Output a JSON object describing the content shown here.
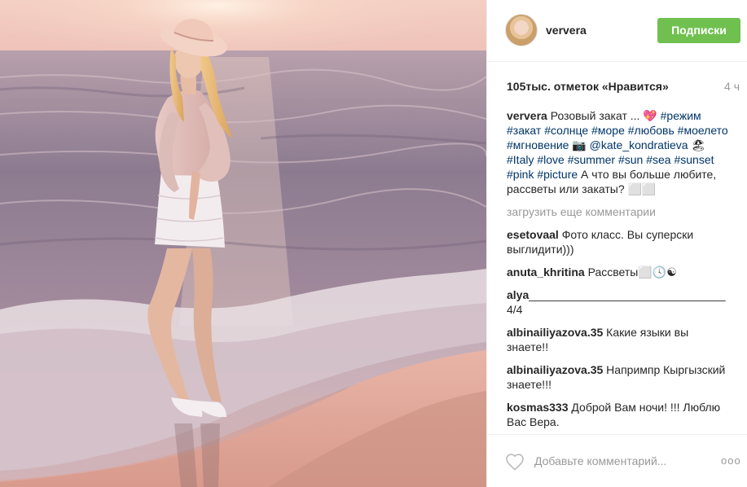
{
  "post": {
    "username": "ververa",
    "follow_label": "Подписки",
    "likes": "105тыс. отметок «Нравится»",
    "time": "4 ч",
    "caption": {
      "user": "ververa",
      "t1": " Розовый закат ... 💖 ",
      "h1": "#режим",
      "s1": " ",
      "h2": "#закат",
      "s2": " ",
      "h3": "#солнце",
      "s3": " ",
      "h4": "#море",
      "s4": " ",
      "h5": "#любовь",
      "s5": " ",
      "h6": "#моелето",
      "s6": " ",
      "h7": "#мгновение",
      "t2": " 📷 ",
      "m1": "@kate_kondratieva",
      "t3": " 🏖 ",
      "h8": "#Italy",
      "s8": " ",
      "h9": "#love",
      "s9": " ",
      "h10": "#summer",
      "s10": " ",
      "h11": "#sun",
      "s11": " ",
      "h12": "#sea",
      "s12": " ",
      "h13": "#sunset",
      "s13": " ",
      "h14": "#pink",
      "s14": " ",
      "h15": "#picture",
      "t4": " А что вы больше любите, рассветы или закаты? ⬜⬜"
    },
    "load_more": "загрузить еще комментарии",
    "comments": [
      {
        "user": "esetovaal",
        "text": " Фото класс. Вы суперски выглидити)))"
      },
      {
        "user": "anuta_khritina",
        "text": " Рассветы⬜🕓☯"
      },
      {
        "user": "alya",
        "text": "_______________________________ 4/4"
      },
      {
        "user": "albinailiyazova.35",
        "text": " Какие языки вы знаете!!"
      },
      {
        "user": "albinailiyazova.35",
        "text": " Напримпр Кыргызский знаете!!!"
      },
      {
        "user": "kosmas333",
        "text": " Доброй Вам ночи! !!! Люблю Вас Вера."
      }
    ],
    "add_comment_placeholder": "Добавьте комментарий...",
    "more_label": "ooo",
    "icons": {
      "like": "heart-icon",
      "more": "more-options-icon"
    }
  }
}
